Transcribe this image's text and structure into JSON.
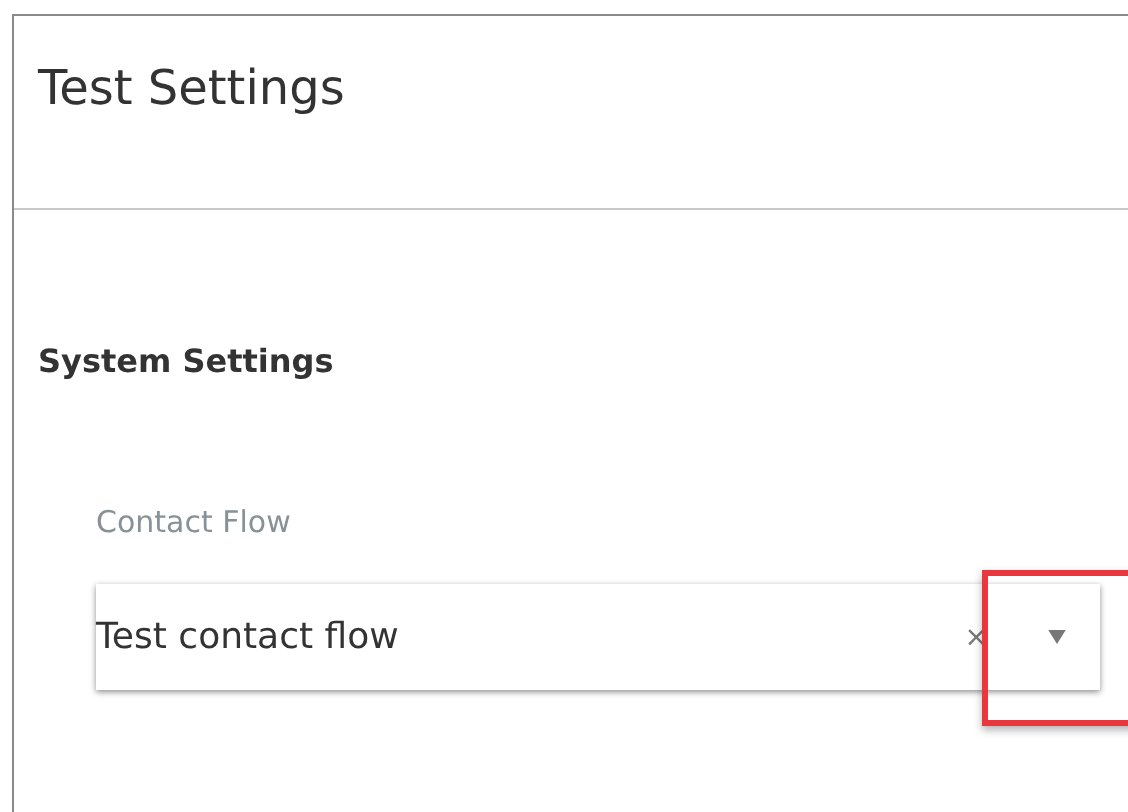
{
  "panel": {
    "title": "Test Settings"
  },
  "section": {
    "heading": "System Settings"
  },
  "field": {
    "label": "Contact Flow",
    "value": "Test contact flow",
    "clear_icon": "×",
    "caret_highlighted": true
  }
}
